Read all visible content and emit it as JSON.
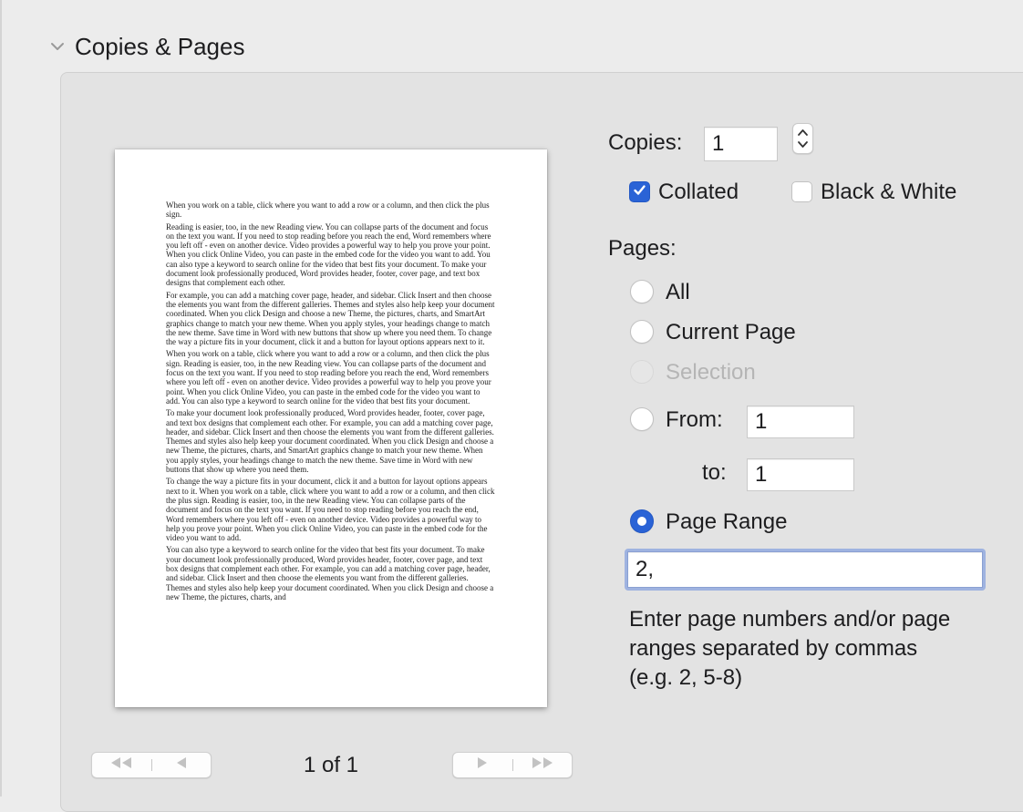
{
  "section": {
    "title": "Copies & Pages",
    "chevron_icon": "chevron-down-icon"
  },
  "preview": {
    "paragraphs": [
      "When you work on a table, click where you want to add a row or a column, and then click the plus sign.",
      "Reading is easier, too, in the new Reading view. You can collapse parts of the document and focus on the text you want. If you need to stop reading before you reach the end, Word remembers where you left off - even on another device. Video provides a powerful way to help you prove your point. When you click Online Video, you can paste in the embed code for the video you want to add. You can also type a keyword to search online for the video that best fits your document. To make your document look professionally produced, Word provides header, footer, cover page, and text box designs that complement each other.",
      "For example, you can add a matching cover page, header, and sidebar. Click Insert and then choose the elements you want from the different galleries. Themes and styles also help keep your document coordinated. When you click Design and choose a new Theme, the pictures, charts, and SmartArt graphics change to match your new theme. When you apply styles, your headings change to match the new theme. Save time in Word with new buttons that show up where you need them. To change the way a picture fits in your document, click it and a button for layout options appears next to it.",
      "When you work on a table, click where you want to add a row or a column, and then click the plus sign. Reading is easier, too, in the new Reading view. You can collapse parts of the document and focus on the text you want. If you need to stop reading before you reach the end, Word remembers where you left off - even on another device. Video provides a powerful way to help you prove your point. When you click Online Video, you can paste in the embed code for the video you want to add. You can also type a keyword to search online for the video that best fits your document.",
      "To make your document look professionally produced, Word provides header, footer, cover page, and text box designs that complement each other. For example, you can add a matching cover page, header, and sidebar. Click Insert and then choose the elements you want from the different galleries. Themes and styles also help keep your document coordinated. When you click Design and choose a new Theme, the pictures, charts, and SmartArt graphics change to match your new theme. When you apply styles, your headings change to match the new theme. Save time in Word with new buttons that show up where you need them.",
      "To change the way a picture fits in your document, click it and a button for layout options appears next to it. When you work on a table, click where you want to add a row or a column, and then click the plus sign. Reading is easier, too, in the new Reading view. You can collapse parts of the document and focus on the text you want. If you need to stop reading before you reach the end, Word remembers where you left off - even on another device. Video provides a powerful way to help you prove your point. When you click Online Video, you can paste in the embed code for the video you want to add.",
      "You can also type a keyword to search online for the video that best fits your document. To make your document look professionally produced, Word provides header, footer, cover page, and text box designs that complement each other. For example, you can add a matching cover page, header, and sidebar. Click Insert and then choose the elements you want from the different galleries. Themes and styles also help keep your document coordinated. When you click Design and choose a new Theme, the pictures, charts, and"
    ]
  },
  "navigation": {
    "page_counter": "1 of 1",
    "first_icon": "first-page-icon",
    "prev_icon": "previous-page-icon",
    "next_icon": "next-page-icon",
    "last_icon": "last-page-icon"
  },
  "copies": {
    "label": "Copies:",
    "value": "1",
    "stepper_icon": "stepper-arrows-icon"
  },
  "options": {
    "collated_label": "Collated",
    "collated_checked": true,
    "bw_label": "Black & White",
    "bw_checked": false
  },
  "pages": {
    "label": "Pages:",
    "all_label": "All",
    "current_label": "Current Page",
    "selection_label": "Selection",
    "from_label": "From:",
    "from_value": "1",
    "to_label": "to:",
    "to_value": "1",
    "range_label": "Page Range",
    "range_value": "2,",
    "range_hint": "Enter page numbers and/or page ranges separated by commas (e.g. 2, 5-8)",
    "selected": "Page Range"
  },
  "colors": {
    "accent": "#2a63d6",
    "focus_ring": "#9fb3e0",
    "panel": "#e3e3e3",
    "background": "#ececec"
  }
}
